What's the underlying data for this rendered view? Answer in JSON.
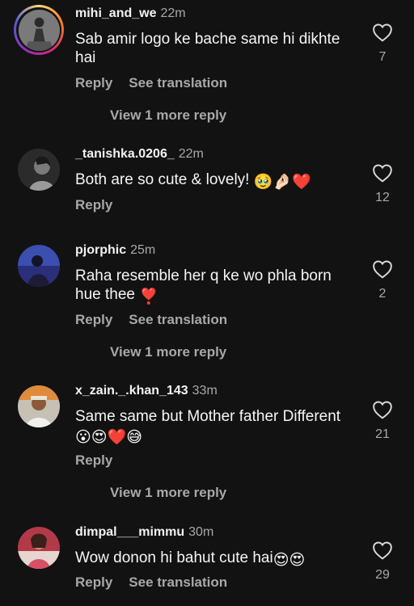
{
  "comments": [
    {
      "username": "mihi_and_we",
      "time": "22m",
      "text": "Sab amir logo ke bache same hi dikhte hai",
      "emoji": "",
      "likes": "7",
      "reply": "Reply",
      "translate": "See translation",
      "more": "View 1 more reply"
    },
    {
      "username": "_tanishka.0206_",
      "time": "22m",
      "text": "Both are so cute & lovely! ",
      "emoji": "🥹🤌🏻❤️",
      "likes": "12",
      "reply": "Reply"
    },
    {
      "username": "pjorphic",
      "time": "25m",
      "text": "Raha resemble her q ke wo phla born hue thee ",
      "emoji": "❣️",
      "likes": "2",
      "reply": "Reply",
      "translate": "See translation",
      "more": "View 1 more reply"
    },
    {
      "username": "x_zain._.khan_143",
      "time": "33m",
      "text": "Same same but Mother father Different ",
      "emoji": "😮😍❤️😅",
      "likes": "21",
      "reply": "Reply",
      "more": "View 1 more reply"
    },
    {
      "username": "dimpal___mimmu",
      "time": "30m",
      "text": "Wow donon hi bahut cute hai",
      "emoji": "😍😍",
      "likes": "29",
      "reply": "Reply",
      "translate": "See translation"
    }
  ],
  "icons": {
    "like": "heart-outline-icon"
  },
  "colors": {
    "background": "#121212",
    "text": "#f5f5f5",
    "secondary": "#a8a8a8"
  }
}
